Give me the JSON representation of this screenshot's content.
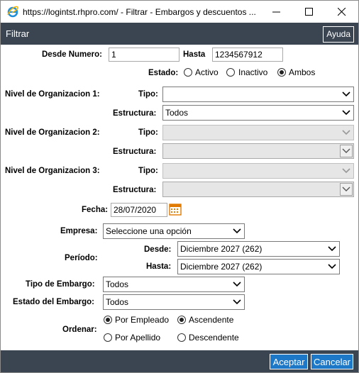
{
  "window": {
    "title": "https://logintst.rhpro.com/ - Filtrar - Embargos y descuentos ...",
    "controls": [
      "minimize-icon",
      "maximize-icon",
      "close-icon"
    ]
  },
  "header": {
    "title": "Filtrar",
    "help_label": "Ayuda"
  },
  "desde_numero": {
    "label": "Desde Numero:",
    "value": "1"
  },
  "hasta": {
    "label": "Hasta",
    "value": "1234567912"
  },
  "estado": {
    "label": "Estado:",
    "options": [
      {
        "label": "Activo",
        "checked": false
      },
      {
        "label": "Inactivo",
        "checked": false
      },
      {
        "label": "Ambos",
        "checked": true
      }
    ]
  },
  "niveles": [
    {
      "label": "Nivel de Organizacion 1:",
      "tipo_label": "Tipo:",
      "tipo_value": "",
      "estructura_label": "Estructura:",
      "estructura_value": "Todos",
      "enabled": true
    },
    {
      "label": "Nivel de Organizacion 2:",
      "tipo_label": "Tipo:",
      "tipo_value": "",
      "estructura_label": "Estructura:",
      "estructura_value": "",
      "enabled": false
    },
    {
      "label": "Nivel de Organizacion 3:",
      "tipo_label": "Tipo:",
      "tipo_value": "",
      "estructura_label": "Estructura:",
      "estructura_value": "",
      "enabled": false
    }
  ],
  "fecha": {
    "label": "Fecha:",
    "value": "28/07/2020"
  },
  "empresa": {
    "label": "Empresa:",
    "value": "Seleccione una opción"
  },
  "periodo": {
    "label": "Período:",
    "desde_label": "Desde:",
    "desde_value": "Diciembre 2027 (262)",
    "hasta_label": "Hasta:",
    "hasta_value": "Diciembre 2027 (262)"
  },
  "tipo_embargo": {
    "label": "Tipo de Embargo:",
    "value": "Todos"
  },
  "estado_embargo": {
    "label": "Estado del Embargo:",
    "value": "Todos"
  },
  "ordenar": {
    "label": "Ordenar:",
    "by": [
      {
        "label": "Por Empleado",
        "checked": true
      },
      {
        "label": "Por Apellido",
        "checked": false
      }
    ],
    "dir": [
      {
        "label": "Ascendente",
        "checked": true
      },
      {
        "label": "Descendente",
        "checked": false
      }
    ]
  },
  "footer": {
    "accept_label": "Aceptar",
    "cancel_label": "Cancelar"
  },
  "colors": {
    "header_bg": "#3b4552",
    "button_bg": "#1d78c7"
  }
}
